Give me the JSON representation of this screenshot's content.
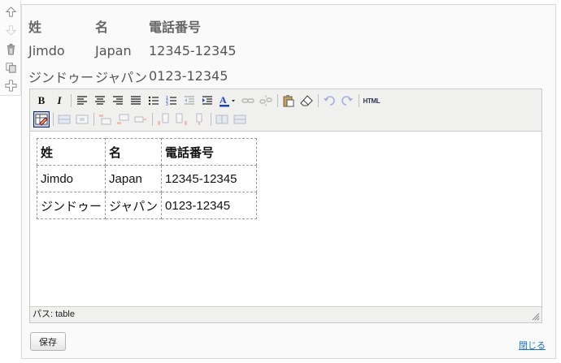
{
  "preview_table": {
    "headers": [
      "姓",
      "名",
      "電話番号"
    ],
    "rows": [
      [
        "Jimdo",
        "Japan",
        "12345-12345"
      ],
      [
        "ジンドゥー",
        "ジャパン",
        "0123-12345"
      ]
    ]
  },
  "editor": {
    "table": {
      "headers": [
        "姓",
        "名",
        "電話番号"
      ],
      "rows": [
        [
          "Jimdo",
          "Japan",
          "12345-12345"
        ],
        [
          "ジンドゥー",
          "ジャパン",
          "0123-12345"
        ]
      ]
    },
    "toolbar": {
      "bold_label": "B",
      "italic_label": "I",
      "html_label": "HTML",
      "font_color_label": "A"
    },
    "status_path": "パス: table"
  },
  "actions": {
    "save_label": "保存",
    "close_label": "閉じる"
  },
  "colors": {
    "link": "#1a73c9",
    "font_color_accent": "#1a3fc9"
  }
}
